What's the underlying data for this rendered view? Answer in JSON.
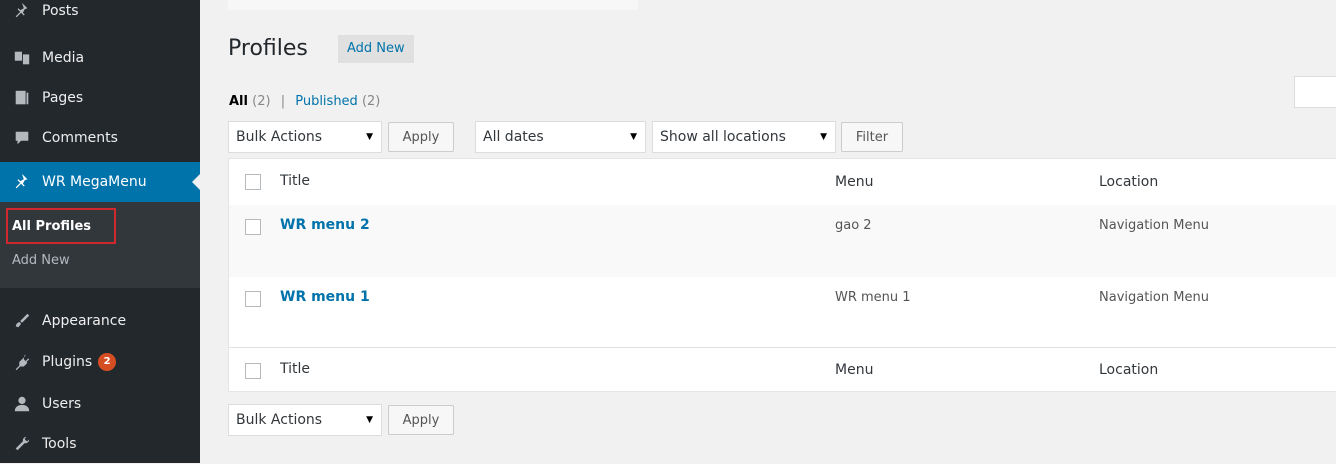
{
  "sidebar": {
    "items": [
      {
        "label": "Posts",
        "icon": "pin-icon"
      },
      {
        "label": "Media",
        "icon": "media-icon"
      },
      {
        "label": "Pages",
        "icon": "pages-icon"
      },
      {
        "label": "Comments",
        "icon": "comment-icon"
      },
      {
        "label": "WR MegaMenu",
        "icon": "pin-icon"
      },
      {
        "label": "Appearance",
        "icon": "brush-icon"
      },
      {
        "label": "Plugins",
        "icon": "plug-icon",
        "badge": "2"
      },
      {
        "label": "Users",
        "icon": "user-icon"
      },
      {
        "label": "Tools",
        "icon": "wrench-icon"
      }
    ],
    "submenu": [
      {
        "label": "All Profiles"
      },
      {
        "label": "Add New"
      }
    ]
  },
  "page": {
    "title": "Profiles",
    "add_new": "Add New"
  },
  "filters": {
    "all_label": "All",
    "all_count": "(2)",
    "separator": "|",
    "published_label": "Published",
    "published_count": "(2)"
  },
  "toolbar": {
    "bulk_actions": "Bulk Actions",
    "apply": "Apply",
    "dates": "All dates",
    "locations": "Show all locations",
    "filter": "Filter"
  },
  "table": {
    "columns": [
      "Title",
      "Menu",
      "Location"
    ],
    "rows": [
      {
        "title": "WR menu 2",
        "menu": "gao 2",
        "location": "Navigation Menu"
      },
      {
        "title": "WR menu 1",
        "menu": "WR menu 1",
        "location": "Navigation Menu"
      }
    ]
  },
  "colors": {
    "sidebar_bg": "#23282d",
    "active_bg": "#0073aa",
    "link": "#0073aa",
    "badge": "#d54e21",
    "highlight_border": "#d0282f"
  }
}
